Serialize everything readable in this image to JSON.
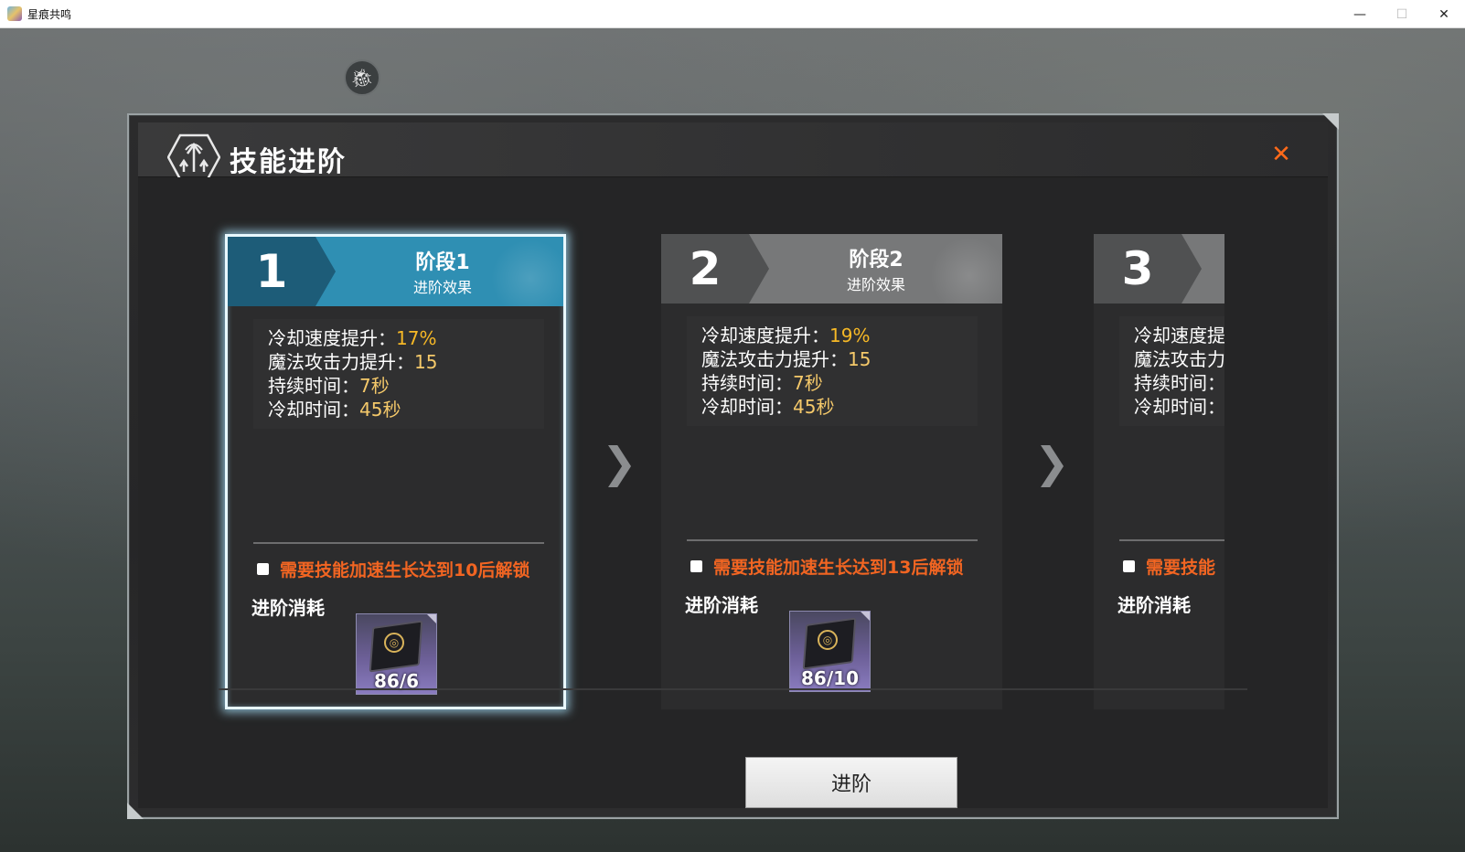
{
  "window": {
    "title": "星痕共鸣",
    "controls": {
      "minimize": "—",
      "maximize": "☐",
      "close": "✕"
    }
  },
  "hud": {
    "bug_icon": "bug-icon"
  },
  "dialog": {
    "title": "技能进阶",
    "header_icon": "skill-advance-icon",
    "close_icon": "close-icon",
    "advance_button": "进阶",
    "stages": [
      {
        "number": "1",
        "label": "阶段1",
        "sub": "进阶效果",
        "selected": true,
        "stats": [
          {
            "label": "冷却速度提升：",
            "value": "17%",
            "highlight": true
          },
          {
            "label": "魔法攻击力提升：",
            "value": "15"
          },
          {
            "label": "持续时间：",
            "value": "7秒"
          },
          {
            "label": "冷却时间：",
            "value": "45秒"
          }
        ],
        "lock_text": "需要技能加速生长达到10后解锁",
        "cost_label": "进阶消耗",
        "item_count": "86/6"
      },
      {
        "number": "2",
        "label": "阶段2",
        "sub": "进阶效果",
        "selected": false,
        "stats": [
          {
            "label": "冷却速度提升：",
            "value": "19%",
            "highlight": true
          },
          {
            "label": "魔法攻击力提升：",
            "value": "15"
          },
          {
            "label": "持续时间：",
            "value": "7秒"
          },
          {
            "label": "冷却时间：",
            "value": "45秒"
          }
        ],
        "lock_text": "需要技能加速生长达到13后解锁",
        "cost_label": "进阶消耗",
        "item_count": "86/10"
      },
      {
        "number": "3",
        "label": "",
        "sub": "",
        "selected": false,
        "stats": [
          {
            "label": "冷却速度提",
            "value": ""
          },
          {
            "label": "魔法攻击力",
            "value": ""
          },
          {
            "label": "持续时间：",
            "value": ""
          },
          {
            "label": "冷却时间：",
            "value": ""
          }
        ],
        "lock_text": "需要技能",
        "cost_label": "进阶消耗",
        "item_count": ""
      }
    ]
  },
  "colors": {
    "stage_active_blue": "#2f8fb3",
    "stage_active_dark": "#1d5c78",
    "stage_inactive_gray": "#777879",
    "stage_inactive_dark": "#505152",
    "lock_orange": "#f26522",
    "value_gold": "#f6b826",
    "close_orange": "#ff6a1a"
  }
}
